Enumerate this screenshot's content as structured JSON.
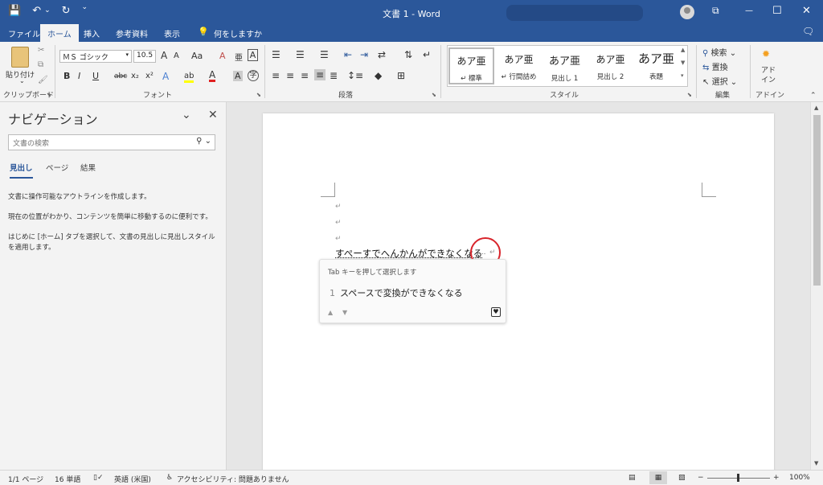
{
  "titlebar": {
    "title": "文書 1  -  Word",
    "qat": {
      "save_icon": "💾",
      "undo_icon": "↶",
      "undo_dd": "⌄",
      "redo_icon": "↻",
      "customize_icon": "⌄"
    },
    "window": {
      "ribbon_opts": "⧉",
      "minimize": "—",
      "maximize": "☐",
      "close": "✕"
    }
  },
  "tabs": [
    "ファイル",
    "ホーム",
    "挿入",
    "参考資料",
    "表示"
  ],
  "tell_me": {
    "icon": "💡",
    "label": "何をしますか"
  },
  "comments_icon": "🗨",
  "ribbon": {
    "clipboard": {
      "paste": "貼り付け",
      "group": "クリップボード"
    },
    "font": {
      "name": "ＭＳ ゴシック",
      "size": "10.5",
      "grow": "A",
      "shrink": "A",
      "case": "Aa",
      "clear": "A",
      "phonetic": "亜",
      "border": "A",
      "bold": "B",
      "italic": "I",
      "underline": "U",
      "strike": "abc",
      "sub": "x₂",
      "sup": "x²",
      "effects": "A",
      "highlight": "ab",
      "color": "A",
      "shade": "A",
      "enclose": "字",
      "group": "フォント"
    },
    "paragraph": {
      "group": "段落"
    },
    "styles": {
      "items": [
        {
          "sample": "あア亜",
          "name": "↵ 標準"
        },
        {
          "sample": "あア亜",
          "name": "↵ 行間詰め"
        },
        {
          "sample": "あア亜",
          "name": "見出し 1"
        },
        {
          "sample": "あア亜",
          "name": "見出し 2"
        },
        {
          "sample": "あア亜",
          "name": "表題"
        }
      ],
      "group": "スタイル"
    },
    "editing": {
      "find": "検索",
      "replace": "置換",
      "select": "選択",
      "group": "編集"
    },
    "addins": {
      "label": "アド イン",
      "group": "アドイン"
    }
  },
  "nav": {
    "title": "ナビゲーション",
    "search_placeholder": "文書の検索",
    "tabs": [
      "見出し",
      "ページ",
      "結果"
    ],
    "info": [
      "文書に操作可能なアウトラインを作成します。",
      "現在の位置がわかり、コンテンツを簡単に移動するのに便利です。",
      "はじめに [ホーム] タブを選択して、文書の見出しに見出しスタイルを適用します。"
    ]
  },
  "doc": {
    "para_mark": "↵",
    "typed": "すぺーすでへんかんができなくなる",
    "dots": "....",
    "ime": {
      "hint": "Tab キーを押して選択します",
      "num": "1",
      "candidate": "スペースで変換ができなくなる",
      "up": "▲",
      "down": "▼",
      "fav": "♥"
    }
  },
  "status": {
    "page": "1/1 ページ",
    "words": "16 単語",
    "lang": "英語 (米国)",
    "access": "アクセシビリティ: 問題ありません",
    "zoom": "100%",
    "minus": "−",
    "plus": "+"
  }
}
